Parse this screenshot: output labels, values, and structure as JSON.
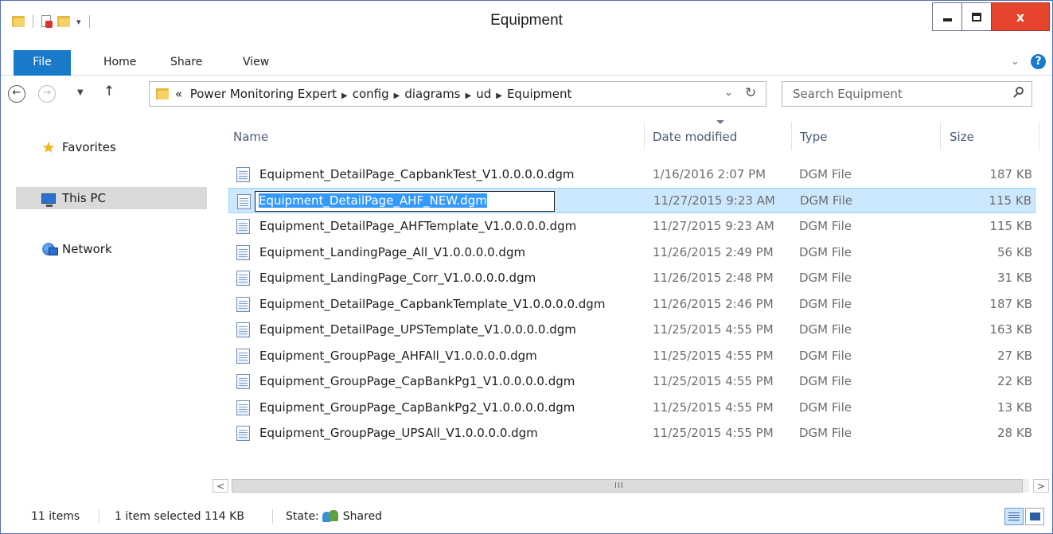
{
  "window": {
    "title": "Equipment",
    "controls": {
      "minimize": "minimize",
      "maximize": "maximize",
      "close": "x"
    }
  },
  "ribbon": {
    "tabs": [
      "File",
      "Home",
      "Share",
      "View"
    ],
    "help_label": "?"
  },
  "address": {
    "prefix": "«",
    "crumbs": [
      "Power Monitoring Expert",
      "config",
      "diagrams",
      "ud",
      "Equipment"
    ],
    "search_placeholder": "Search Equipment"
  },
  "nav_pane": {
    "items": [
      {
        "label": "Favorites",
        "icon": "star-icon"
      },
      {
        "label": "This PC",
        "icon": "computer-icon"
      },
      {
        "label": "Network",
        "icon": "network-icon"
      }
    ]
  },
  "columns": {
    "name": "Name",
    "date": "Date modified",
    "type": "Type",
    "size": "Size"
  },
  "files": [
    {
      "name": "Equipment_DetailPage_CapbankTest_V1.0.0.0.0.dgm",
      "date": "1/16/2016 2:07 PM",
      "type": "DGM File",
      "size": "187 KB"
    },
    {
      "name": "Equipment_DetailPage_AHF_NEW.dgm",
      "date": "11/27/2015 9:23 AM",
      "type": "DGM File",
      "size": "115 KB",
      "selected": true,
      "renaming": true
    },
    {
      "name": "Equipment_DetailPage_AHFTemplate_V1.0.0.0.0.dgm",
      "date": "11/27/2015 9:23 AM",
      "type": "DGM File",
      "size": "115 KB"
    },
    {
      "name": "Equipment_LandingPage_All_V1.0.0.0.0.dgm",
      "date": "11/26/2015 2:49 PM",
      "type": "DGM File",
      "size": "56 KB"
    },
    {
      "name": "Equipment_LandingPage_Corr_V1.0.0.0.0.dgm",
      "date": "11/26/2015 2:48 PM",
      "type": "DGM File",
      "size": "31 KB"
    },
    {
      "name": "Equipment_DetailPage_CapbankTemplate_V1.0.0.0.0.dgm",
      "date": "11/26/2015 2:46 PM",
      "type": "DGM File",
      "size": "187 KB"
    },
    {
      "name": "Equipment_DetailPage_UPSTemplate_V1.0.0.0.0.dgm",
      "date": "11/25/2015 4:55 PM",
      "type": "DGM File",
      "size": "163 KB"
    },
    {
      "name": "Equipment_GroupPage_AHFAll_V1.0.0.0.0.dgm",
      "date": "11/25/2015 4:55 PM",
      "type": "DGM File",
      "size": "27 KB"
    },
    {
      "name": "Equipment_GroupPage_CapBankPg1_V1.0.0.0.0.dgm",
      "date": "11/25/2015 4:55 PM",
      "type": "DGM File",
      "size": "22 KB"
    },
    {
      "name": "Equipment_GroupPage_CapBankPg2_V1.0.0.0.0.dgm",
      "date": "11/25/2015 4:55 PM",
      "type": "DGM File",
      "size": "13 KB"
    },
    {
      "name": "Equipment_GroupPage_UPSAll_V1.0.0.0.0.dgm",
      "date": "11/25/2015 4:55 PM",
      "type": "DGM File",
      "size": "28 KB"
    }
  ],
  "status": {
    "count": "11 items",
    "selection": "1 item selected  114 KB",
    "state_label": "State:",
    "state_value": "Shared"
  },
  "colors": {
    "accent": "#1979ca",
    "selection_bg": "#cce8ff",
    "close_button": "#e5442d"
  }
}
